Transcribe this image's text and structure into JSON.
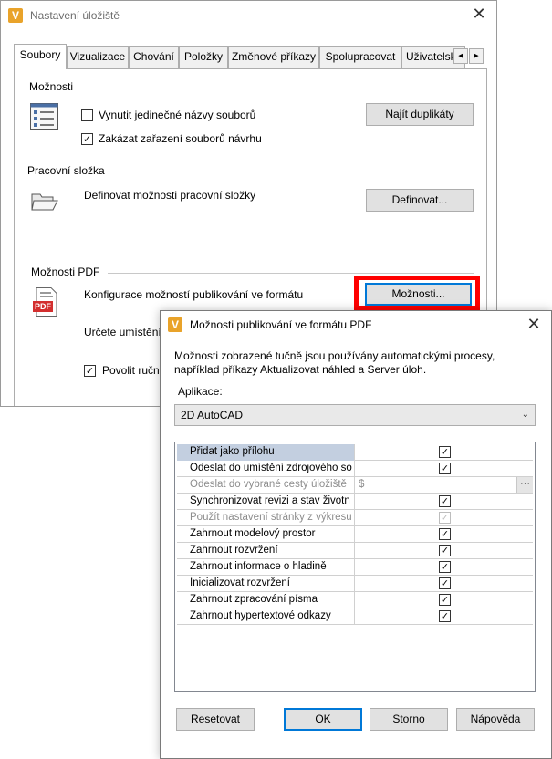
{
  "main_window": {
    "title": "Nastavení úložiště",
    "tabs": [
      "Soubory",
      "Vizualizace",
      "Chování",
      "Položky",
      "Změnové příkazy",
      "Spolupracovat",
      "Uživatelsk"
    ],
    "active_tab": "Soubory",
    "options_group": {
      "label": "Možnosti",
      "checkbox1": {
        "label": "Vynutit jedinečné názvy souborů",
        "checked": false
      },
      "checkbox2": {
        "label": "Zakázat zařazení souborů návrhu",
        "checked": true
      },
      "find_duplicates_button": "Najít duplikáty"
    },
    "working_folder_group": {
      "label": "Pracovní složka",
      "description": "Definovat možnosti pracovní složky",
      "define_button": "Definovat..."
    },
    "pdf_group": {
      "label": "Možnosti PDF",
      "description": "Konfigurace možností publikování ve formátu",
      "pdf_icon_text": "PDF",
      "options_button": "Možnosti...",
      "location_text": "Určete umístění",
      "allow_checkbox": {
        "label": "Povolit ručn",
        "checked": true
      }
    }
  },
  "pdf_dialog": {
    "title": "Možnosti publikování ve formátu PDF",
    "description": "Možnosti zobrazené tučně jsou používány automatickými procesy, například příkazy Aktualizovat náhled a Server úloh.",
    "application_label": "Aplikace:",
    "application_value": "2D AutoCAD",
    "rows": [
      {
        "name": "Přidat jako přílohu",
        "checked": true,
        "disabled": false,
        "selected": true
      },
      {
        "name": "Odeslat do umístění zdrojového so",
        "checked": true,
        "disabled": false,
        "selected": false
      },
      {
        "name": "Odeslat do vybrané cesty úložiště",
        "value": "$",
        "disabled": true,
        "selected": false
      },
      {
        "name": "Synchronizovat revizi a stav životn",
        "checked": true,
        "disabled": false,
        "selected": false
      },
      {
        "name": "Použít nastavení stránky z výkresu",
        "checked": true,
        "disabled": true,
        "selected": false
      },
      {
        "name": "Zahrnout modelový prostor",
        "checked": true,
        "disabled": false,
        "selected": false
      },
      {
        "name": "Zahrnout rozvržení",
        "checked": true,
        "disabled": false,
        "selected": false
      },
      {
        "name": "Zahrnout informace o hladině",
        "checked": true,
        "disabled": false,
        "selected": false
      },
      {
        "name": "Inicializovat rozvržení",
        "checked": true,
        "disabled": false,
        "selected": false
      },
      {
        "name": "Zahrnout zpracování písma",
        "checked": true,
        "disabled": false,
        "selected": false
      },
      {
        "name": "Zahrnout hypertextové odkazy",
        "checked": true,
        "disabled": false,
        "selected": false
      }
    ],
    "buttons": {
      "reset": "Resetovat",
      "ok": "OK",
      "cancel": "Storno",
      "help": "Nápověda"
    }
  },
  "icons": {
    "app": "autodesk-vault-icon",
    "close": "close-icon",
    "check_glyph": "✓",
    "ellipsis_glyph": "···"
  },
  "colors": {
    "highlight": "#ff0000",
    "focus": "#0078d7",
    "selected_row": "#c3cfe0",
    "app_icon": "#e9a32a"
  }
}
